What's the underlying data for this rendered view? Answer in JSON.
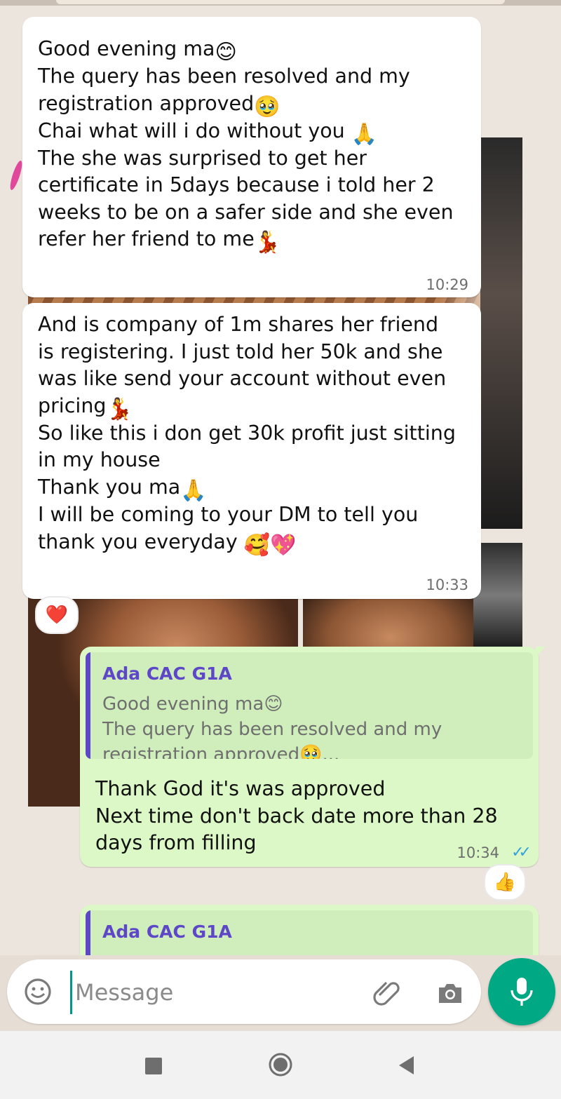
{
  "messages": [
    {
      "line1": "Good evening ma",
      "line1_emoji": "😊",
      "line2": "The query has been resolved and my",
      "line3": "registration approved",
      "line3_emoji": "🥹",
      "line4": "Chai what will i do without you ",
      "line4_emoji": "🙏",
      "line5": "The she was surprised to get her\ncertificate in 5days because i told her 2\nweeks to be on a safer side and she even",
      "line6": "refer her friend to me",
      "line6_emoji": "💃",
      "time": "10:29"
    },
    {
      "line1": "And is company of 1m shares her friend\nis registering. I just told her 50k and she\nwas like send your account without even",
      "line2": "pricing",
      "line2_emoji": "💃",
      "line3": "So like this i don get 30k profit just sitting\nin my house",
      "line4": "Thank you ma",
      "line4_emoji": "🙏",
      "line5": "I will be coming to your DM to tell you",
      "line6": "thank you everyday ",
      "line6_emoji": "🥰💖",
      "time": "10:33",
      "reaction": "❤️"
    },
    {
      "quote_author": "Ada CAC G1A",
      "quote_line1": "Good evening ma",
      "quote_line1_emoji": "😊",
      "quote_line2": "The query has been resolved and my",
      "quote_line3": "registration approved",
      "quote_line3_emoji": "🥹",
      "quote_ellipsis": "...",
      "text": "Thank God it's was approved\nNext time don't back date more than 28\ndays from filling",
      "time": "10:34",
      "reaction": "👍"
    },
    {
      "quote_author": "Ada CAC G1A"
    }
  ],
  "input": {
    "placeholder": "Message"
  },
  "colors": {
    "incoming_bubble": "#ffffff",
    "outgoing_bubble": "#dcf8c6",
    "quote_accent": "#5d46c8",
    "read_ticks": "#34a1e0",
    "mic_button": "#00a884"
  },
  "icons": [
    "emoji-icon",
    "attach-icon",
    "camera-icon",
    "mic-icon",
    "recents-icon",
    "home-icon",
    "back-icon"
  ]
}
